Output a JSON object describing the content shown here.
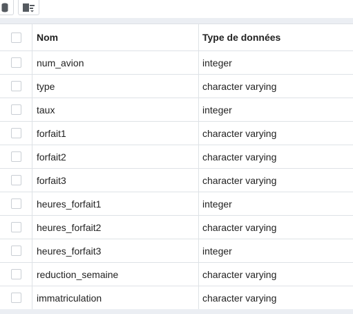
{
  "toolbar": {
    "buttons": [
      {
        "icon": "database-icon"
      },
      {
        "icon": "column-list-dropdown-icon"
      }
    ]
  },
  "table": {
    "headers": {
      "name": "Nom",
      "type": "Type de données"
    },
    "rows": [
      {
        "name": "num_avion",
        "type": "integer"
      },
      {
        "name": "type",
        "type": "character varying"
      },
      {
        "name": "taux",
        "type": "integer"
      },
      {
        "name": "forfait1",
        "type": "character varying"
      },
      {
        "name": "forfait2",
        "type": "character varying"
      },
      {
        "name": "forfait3",
        "type": "character varying"
      },
      {
        "name": "heures_forfait1",
        "type": "integer"
      },
      {
        "name": "heures_forfait2",
        "type": "character varying"
      },
      {
        "name": "heures_forfait3",
        "type": "integer"
      },
      {
        "name": "reduction_semaine",
        "type": "character varying"
      },
      {
        "name": "immatriculation",
        "type": "character varying"
      }
    ]
  },
  "colors": {
    "background": "#ffffff",
    "band": "#ebeef3",
    "border": "#dee2e6",
    "icon": "#555a60"
  }
}
